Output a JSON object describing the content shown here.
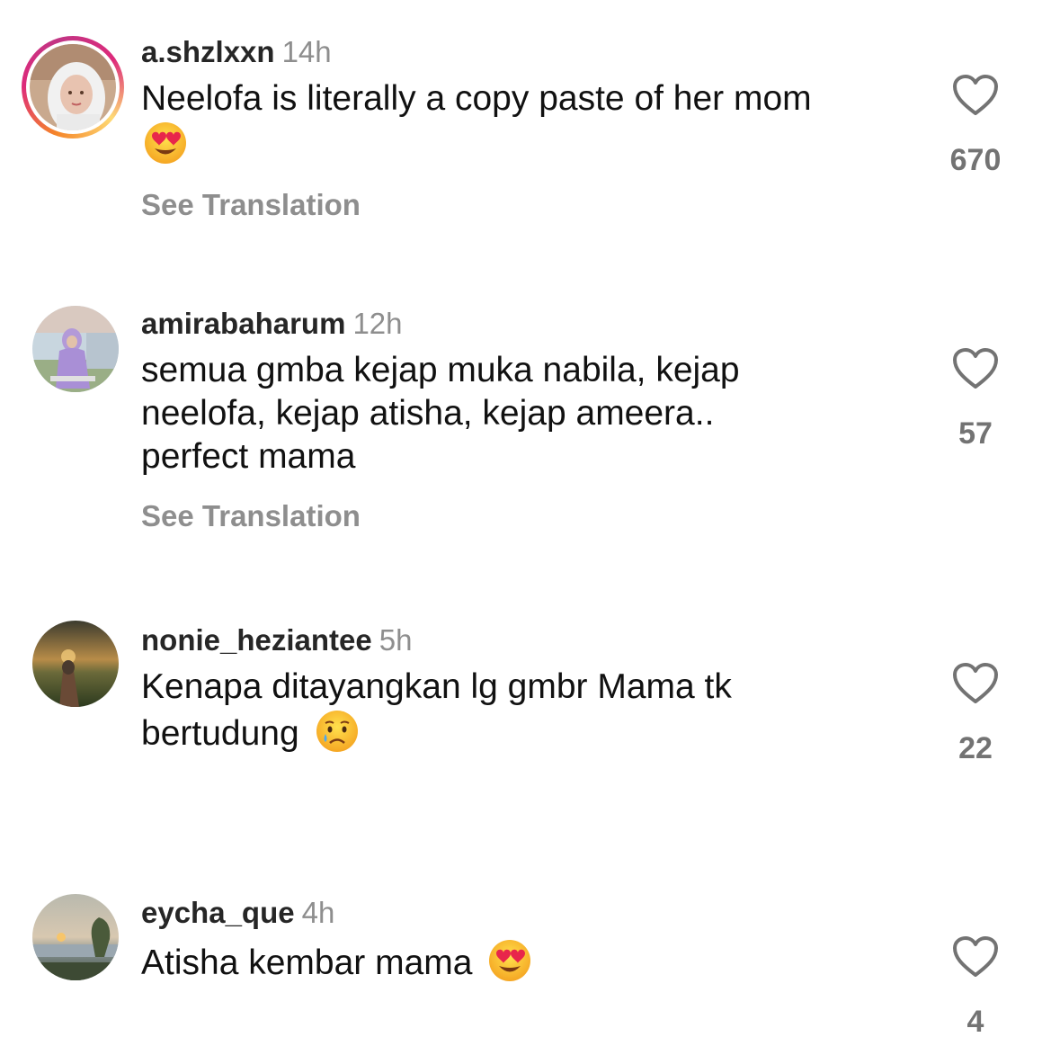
{
  "see_translation_label": "See Translation",
  "colors": {
    "username": "#262626",
    "timestamp": "#8e8e8e",
    "like_count": "#737373",
    "story_ring": "#dd2a7b"
  },
  "comments": [
    {
      "username": "a.shzlxxn",
      "time": "14h",
      "text": "Neelofa is literally a copy paste of her mom",
      "emoji": "heart-eyes-emoji",
      "likes": "670",
      "has_story_ring": true
    },
    {
      "username": "amirabaharum",
      "time": "12h",
      "text": "semua gmba kejap muka nabila, kejap neelofa, kejap atisha, kejap ameera.. perfect mama",
      "likes": "57",
      "has_story_ring": false
    },
    {
      "username": "nonie_heziantee",
      "time": "5h",
      "text": "Kenapa ditayangkan lg gmbr Mama tk bertudung",
      "emoji": "crying-face-emoji",
      "likes": "22",
      "has_story_ring": false
    },
    {
      "username": "eycha_que",
      "time": "4h",
      "text": "Atisha kembar mama",
      "emoji": "heart-eyes-emoji",
      "likes": "4",
      "has_story_ring": false
    }
  ]
}
